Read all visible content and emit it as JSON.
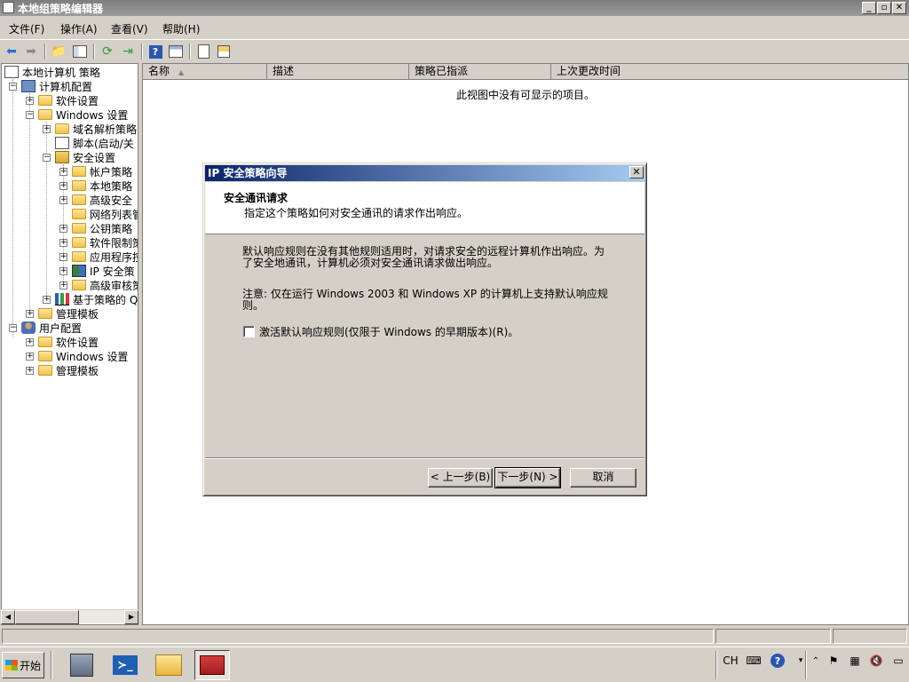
{
  "window": {
    "title": "本地组策略编辑器",
    "buttons": {
      "minimize": "_",
      "restore": "🗗",
      "close": "✕"
    }
  },
  "menu": [
    "文件(F)",
    "操作(A)",
    "查看(V)",
    "帮助(H)"
  ],
  "toolbar": [
    "back-icon",
    "forward-icon",
    "up-icon",
    "show-hide-tree-icon",
    "refresh-icon",
    "export-icon",
    "help-icon",
    "properties-icon",
    "new-icon",
    "import-icon"
  ],
  "tree": {
    "root": "本地计算机 策略",
    "computer_config": "计算机配置",
    "software_settings": "软件设置",
    "windows_settings": "Windows 设置",
    "dns_policy": "域名解析策略",
    "scripts": "脚本(启动/关",
    "security_settings": "安全设置",
    "account_policies": "帐户策略",
    "local_policies": "本地策略",
    "advanced_security": "高级安全",
    "network_list": "网络列表管",
    "public_key": "公钥策略",
    "software_restriction": "软件限制策",
    "app_control": "应用程序控",
    "ip_security": "IP 安全策",
    "advanced_audit": "高级审核策",
    "qos": "基于策略的 Q",
    "admin_templates_computer": "管理模板",
    "user_config": "用户配置",
    "user_software": "软件设置",
    "user_windows": "Windows 设置",
    "user_admin_templates": "管理模板"
  },
  "list": {
    "columns": [
      "名称",
      "描述",
      "策略已指派",
      "上次更改时间"
    ],
    "empty_message": "此视图中没有可显示的项目。"
  },
  "dialog": {
    "title": "IP 安全策略向导",
    "heading": "安全通讯请求",
    "subheading": "指定这个策略如何对安全通讯的请求作出响应。",
    "paragraph1_line1": "默认响应规则在没有其他规则适用时，对请求安全的远程计算机作出响应。为",
    "paragraph1_line2": "了安全地通讯，计算机必须对安全通讯请求做出响应。",
    "paragraph2_line1": "注意: 仅在运行 Windows 2003 和 Windows XP 的计算机上支持默认响应规",
    "paragraph2_line2": "则。",
    "checkbox_label": "激活默认响应规则(仅限于 Windows 的早期版本)(R)。",
    "checkbox_checked": false,
    "back_button": "< 上一步(B)",
    "next_button": "下一步(N) >",
    "cancel_button": "取消"
  },
  "taskbar": {
    "start_label": "开始",
    "language": "CH",
    "apps": [
      "server-manager-icon",
      "powershell-icon",
      "explorer-icon",
      "toolbox-icon"
    ]
  }
}
